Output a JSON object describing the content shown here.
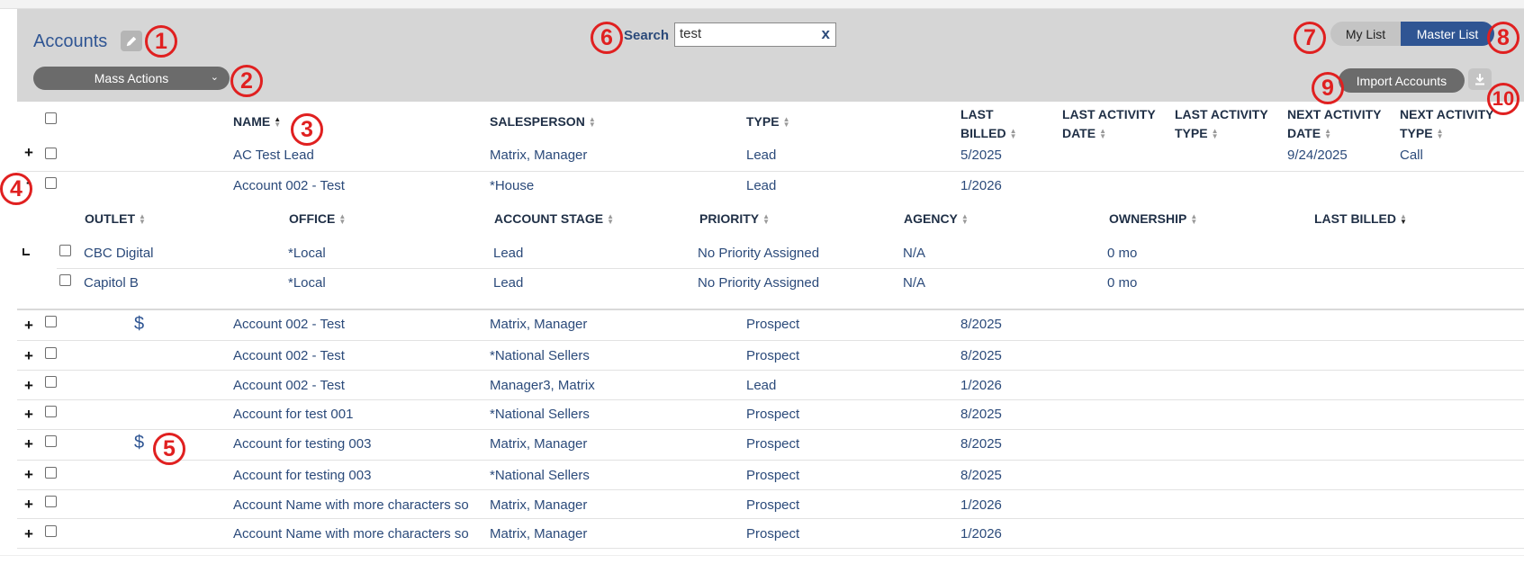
{
  "header": {
    "title": "Accounts",
    "mass_actions_label": "Mass Actions",
    "search_label": "Search",
    "search_value": "test",
    "search_clear": "x",
    "my_list_label": "My List",
    "master_list_label": "Master List",
    "import_label": "Import Accounts"
  },
  "table": {
    "columns": {
      "name": "NAME",
      "salesperson": "SALESPERSON",
      "type": "TYPE",
      "last_billed_1": "LAST",
      "last_billed_2": "BILLED",
      "last_activity_date_1": "LAST ACTIVITY",
      "last_activity_date_2": "DATE",
      "last_activity_type_1": "LAST ACTIVITY",
      "last_activity_type_2": "TYPE",
      "next_activity_date_1": "NEXT ACTIVITY",
      "next_activity_date_2": "DATE",
      "next_activity_type_1": "NEXT ACTIVITY",
      "next_activity_type_2": "TYPE"
    },
    "rows": [
      {
        "expander": "+",
        "name": "AC Test Lead",
        "salesperson": "Matrix, Manager",
        "type": "Lead",
        "last_billed": "5/2025",
        "next_activity_date": "9/24/2025",
        "next_activity_type": "Call"
      },
      {
        "expander": "-",
        "name": "Account 002 - Test",
        "salesperson": "*House",
        "type": "Lead",
        "last_billed": "1/2026"
      },
      {
        "expander": "+",
        "dollar": "$",
        "name": "Account 002 - Test",
        "salesperson": "Matrix, Manager",
        "type": "Prospect",
        "last_billed": "8/2025"
      },
      {
        "expander": "+",
        "name": "Account 002 - Test",
        "salesperson": "*National Sellers",
        "type": "Prospect",
        "last_billed": "8/2025"
      },
      {
        "expander": "+",
        "name": "Account 002 - Test",
        "salesperson": "Manager3, Matrix",
        "type": "Lead",
        "last_billed": "1/2026"
      },
      {
        "expander": "+",
        "name": "Account for test 001",
        "salesperson": "*National Sellers",
        "type": "Prospect",
        "last_billed": "8/2025"
      },
      {
        "expander": "+",
        "dollar": "$",
        "name": "Account for testing 003",
        "salesperson": "Matrix, Manager",
        "type": "Prospect",
        "last_billed": "8/2025"
      },
      {
        "expander": "+",
        "name": "Account for testing 003",
        "salesperson": "*National Sellers",
        "type": "Prospect",
        "last_billed": "8/2025"
      },
      {
        "expander": "+",
        "name": "Account Name with more characters so",
        "salesperson": "Matrix, Manager",
        "type": "Prospect",
        "last_billed": "1/2026"
      },
      {
        "expander": "+",
        "name": "Account Name with more characters so",
        "salesperson": "Matrix, Manager",
        "type": "Prospect",
        "last_billed": "1/2026"
      }
    ]
  },
  "subtable": {
    "columns": {
      "outlet": "OUTLET",
      "office": "OFFICE",
      "account_stage": "ACCOUNT STAGE",
      "priority": "PRIORITY",
      "agency": "AGENCY",
      "ownership": "OWNERSHIP",
      "last_billed": "LAST BILLED"
    },
    "rows": [
      {
        "outlet": "CBC Digital",
        "office": "*Local",
        "account_stage": "Lead",
        "priority": "No Priority Assigned",
        "agency": "N/A",
        "ownership": "0 mo"
      },
      {
        "outlet": "Capitol B",
        "office": "*Local",
        "account_stage": "Lead",
        "priority": "No Priority Assigned",
        "agency": "N/A",
        "ownership": "0 mo"
      }
    ]
  },
  "annotations": [
    "1",
    "2",
    "3",
    "4",
    "5",
    "6",
    "7",
    "8",
    "9",
    "10"
  ],
  "icons": {
    "edit": "pencil-icon",
    "mass_actions_caret": "chevron-down-icon",
    "download": "download-icon",
    "sort": "sort-icon"
  },
  "colors": {
    "accent": "#2f5593",
    "header_band": "#d6d6d6",
    "annotation": "#e02020"
  }
}
